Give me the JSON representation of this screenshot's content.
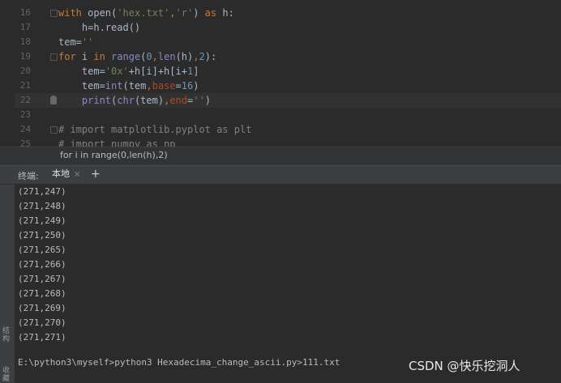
{
  "editor": {
    "lines": [
      {
        "num": "16",
        "tokens": [
          {
            "t": "with ",
            "c": "kw"
          },
          {
            "t": "open",
            "c": "call"
          },
          {
            "t": "(",
            "c": "call"
          },
          {
            "t": "'hex.txt'",
            "c": "str"
          },
          {
            "t": ",",
            "c": "kw"
          },
          {
            "t": "'r'",
            "c": "str"
          },
          {
            "t": ") ",
            "c": "call"
          },
          {
            "t": "as ",
            "c": "kw"
          },
          {
            "t": "h:",
            "c": "call"
          }
        ]
      },
      {
        "num": "17",
        "tokens": [
          {
            "t": "    h=h.read()",
            "c": "call"
          }
        ]
      },
      {
        "num": "18",
        "tokens": [
          {
            "t": "tem=",
            "c": "call"
          },
          {
            "t": "''",
            "c": "str"
          }
        ]
      },
      {
        "num": "19",
        "tokens": [
          {
            "t": "for ",
            "c": "kw"
          },
          {
            "t": "i ",
            "c": "call"
          },
          {
            "t": "in ",
            "c": "kw"
          },
          {
            "t": "range",
            "c": "fn"
          },
          {
            "t": "(",
            "c": "call"
          },
          {
            "t": "0",
            "c": "num"
          },
          {
            "t": ",",
            "c": "kw"
          },
          {
            "t": "len",
            "c": "fn"
          },
          {
            "t": "(h)",
            "c": "call"
          },
          {
            "t": ",",
            "c": "kw"
          },
          {
            "t": "2",
            "c": "num"
          },
          {
            "t": "):",
            "c": "call"
          }
        ]
      },
      {
        "num": "20",
        "tokens": [
          {
            "t": "    tem=",
            "c": "call"
          },
          {
            "t": "'0x'",
            "c": "str"
          },
          {
            "t": "+h[i]+h[i+",
            "c": "call"
          },
          {
            "t": "1",
            "c": "num"
          },
          {
            "t": "]",
            "c": "call"
          }
        ]
      },
      {
        "num": "21",
        "tokens": [
          {
            "t": "    tem=",
            "c": "call"
          },
          {
            "t": "int",
            "c": "fn"
          },
          {
            "t": "(tem",
            "c": "call"
          },
          {
            "t": ",",
            "c": "kw"
          },
          {
            "t": "base",
            "c": "par"
          },
          {
            "t": "=",
            "c": "call"
          },
          {
            "t": "16",
            "c": "num"
          },
          {
            "t": ")",
            "c": "call"
          }
        ]
      },
      {
        "num": "22",
        "tokens": [
          {
            "t": "    ",
            "c": "call"
          },
          {
            "t": "print",
            "c": "fn"
          },
          {
            "t": "(",
            "c": "call"
          },
          {
            "t": "chr",
            "c": "fn"
          },
          {
            "t": "(tem)",
            "c": "call"
          },
          {
            "t": ",",
            "c": "kw"
          },
          {
            "t": "end",
            "c": "par"
          },
          {
            "t": "=",
            "c": "call"
          },
          {
            "t": "''",
            "c": "str"
          },
          {
            "t": ")",
            "c": "call"
          }
        ]
      },
      {
        "num": "23",
        "tokens": []
      },
      {
        "num": "24",
        "tokens": [
          {
            "t": "# import matplotlib.pyplot as plt",
            "c": "com"
          }
        ]
      },
      {
        "num": "25",
        "tokens": [
          {
            "t": "# import numpy as np",
            "c": "com"
          }
        ]
      }
    ]
  },
  "breadcrumb": "for i in range(0,len(h),2)",
  "terminal": {
    "label": "终端:",
    "tab_label": "本地",
    "tab_close": "×",
    "add_tab": "+",
    "output": [
      "(271,247)",
      "(271,248)",
      "(271,249)",
      "(271,250)",
      "(271,265)",
      "(271,266)",
      "(271,267)",
      "(271,268)",
      "(271,269)",
      "(271,270)",
      "(271,271)"
    ],
    "prompt": "E:\\python3\\myself>python3 Hexadecima_change_ascii.py>111.txt"
  },
  "side": {
    "structure": "结构",
    "favorites": "收藏"
  },
  "watermark": "CSDN @快乐挖洞人",
  "colors": {
    "editor_bg": "#2b2b2b",
    "keyword": "#cc7832",
    "string": "#6a8759",
    "number": "#6897bb",
    "builtin": "#8888c6",
    "param": "#aa4926",
    "comment": "#808080",
    "tab_underline": "#4a88c7"
  }
}
